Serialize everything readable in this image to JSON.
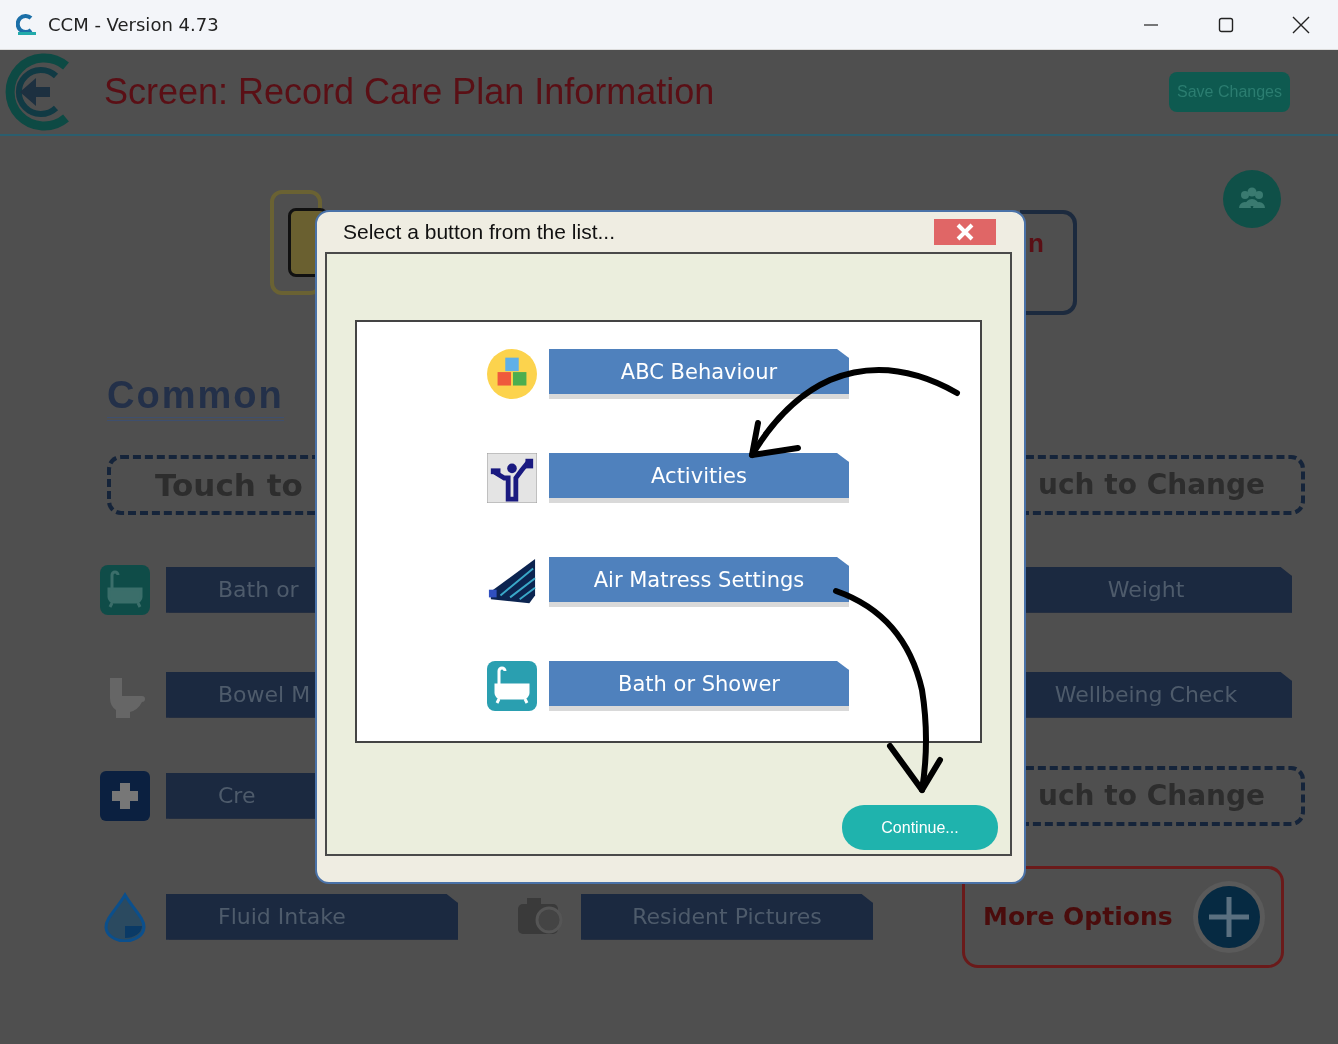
{
  "window": {
    "title": "CCM - Version 4.73"
  },
  "header": {
    "title": "Screen: Record Care Plan Information",
    "save_button": "Save Changes"
  },
  "status_card": {
    "text": "n"
  },
  "section_heading": "Common",
  "left_items": [
    {
      "kind": "touch",
      "text": "Touch to"
    },
    {
      "kind": "button",
      "text": "Bath or"
    },
    {
      "kind": "button",
      "text": "Bowel M"
    },
    {
      "kind": "button",
      "text": "Cre"
    },
    {
      "kind": "button",
      "text": "Fluid Intake"
    }
  ],
  "middle_item": {
    "text": "Resident Pictures"
  },
  "right_items": [
    {
      "kind": "touch",
      "text": "uch to Change"
    },
    {
      "kind": "button",
      "text": "Weight"
    },
    {
      "kind": "button",
      "text": "Wellbeing Check"
    },
    {
      "kind": "touch",
      "text": "uch to Change"
    },
    {
      "kind": "more",
      "text": "More Options"
    }
  ],
  "dialog": {
    "title": "Select a button from the list...",
    "options": [
      {
        "label": "ABC Behaviour"
      },
      {
        "label": "Activities"
      },
      {
        "label": "Air Matress Settings"
      },
      {
        "label": "Bath or Shower"
      }
    ],
    "continue_button": "Continue..."
  }
}
